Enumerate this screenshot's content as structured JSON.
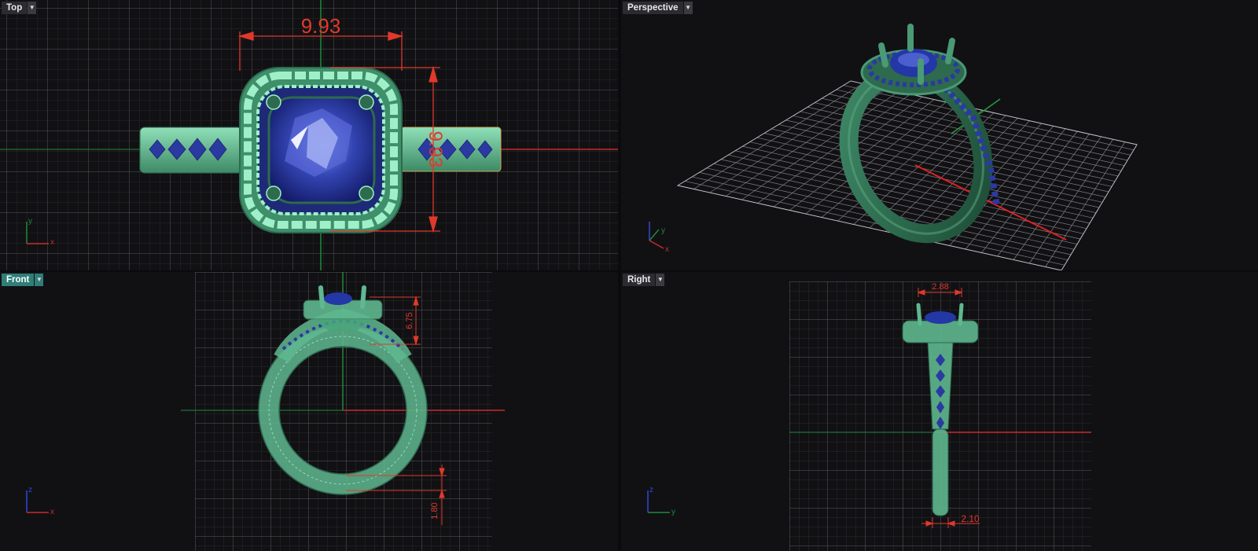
{
  "viewports": {
    "top": {
      "label": "Top",
      "dim_width": "9.93",
      "dim_height": "9.93",
      "axis_x": "x",
      "axis_y": "y"
    },
    "perspective": {
      "label": "Perspective",
      "axis_x": "x",
      "axis_y": "y"
    },
    "front": {
      "label": "Front",
      "dim_height": "6.75",
      "dim_shank": "1.80",
      "axis_x": "x",
      "axis_z": "z"
    },
    "right": {
      "label": "Right",
      "dim_top": "2.88",
      "dim_bottom": "2.10",
      "axis_y": "y",
      "axis_z": "z"
    }
  },
  "active_viewport": "front",
  "colors": {
    "background": "#111114",
    "grid": "#3c3c42",
    "grid_major": "#6c6c72",
    "axis_x": "#c92a2a",
    "axis_y": "#1e8a3a",
    "metal": "#5fb890",
    "metal_dark": "#2e6a4e",
    "gem": "#2e3f9a",
    "dimension": "#e0392b"
  },
  "icons": [
    "dropdown-arrow-icon",
    "axis-triad-icon"
  ]
}
